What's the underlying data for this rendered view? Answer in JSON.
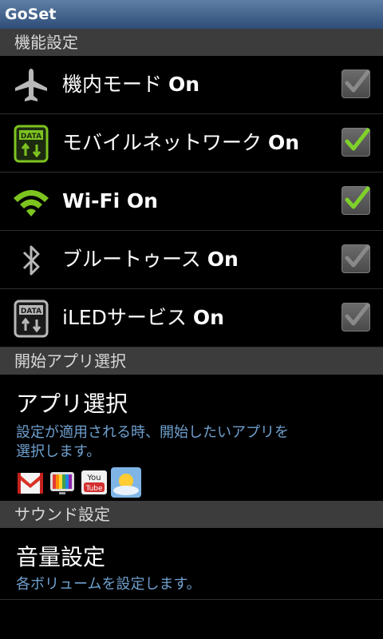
{
  "app": {
    "title": "GoSet"
  },
  "sections": {
    "features": "機能設定",
    "startup_apps": "開始アプリ選択",
    "sound": "サウンド設定"
  },
  "toggles": [
    {
      "label": "機内モード ",
      "state": "On",
      "icon": "airplane-icon",
      "checked": false
    },
    {
      "label": "モバイルネットワーク ",
      "state": "On",
      "icon": "mobile-data-icon",
      "checked": true
    },
    {
      "label": "",
      "state": "Wi-Fi On",
      "icon": "wifi-icon",
      "checked": true
    },
    {
      "label": "ブルートゥース ",
      "state": "On",
      "icon": "bluetooth-icon",
      "checked": false
    },
    {
      "label": "iLEDサービス ",
      "state": "On",
      "icon": "led-data-icon",
      "checked": false
    }
  ],
  "app_select": {
    "title": "アプリ選択",
    "summary_line1": "設定が適用される時、開始したいアプリを",
    "summary_line2": "選択します。",
    "apps": [
      "gmail-icon",
      "tv-icon",
      "youtube-icon",
      "weather-icon"
    ],
    "youtube_text": "You Tube"
  },
  "volume": {
    "title": "音量設定",
    "summary": "各ボリュームを設定します。"
  },
  "colors": {
    "check_green": "#7fd12a",
    "check_gray": "#8a8a8a",
    "summary_blue": "#6fa0cf",
    "wifi_green": "#7dc320"
  }
}
